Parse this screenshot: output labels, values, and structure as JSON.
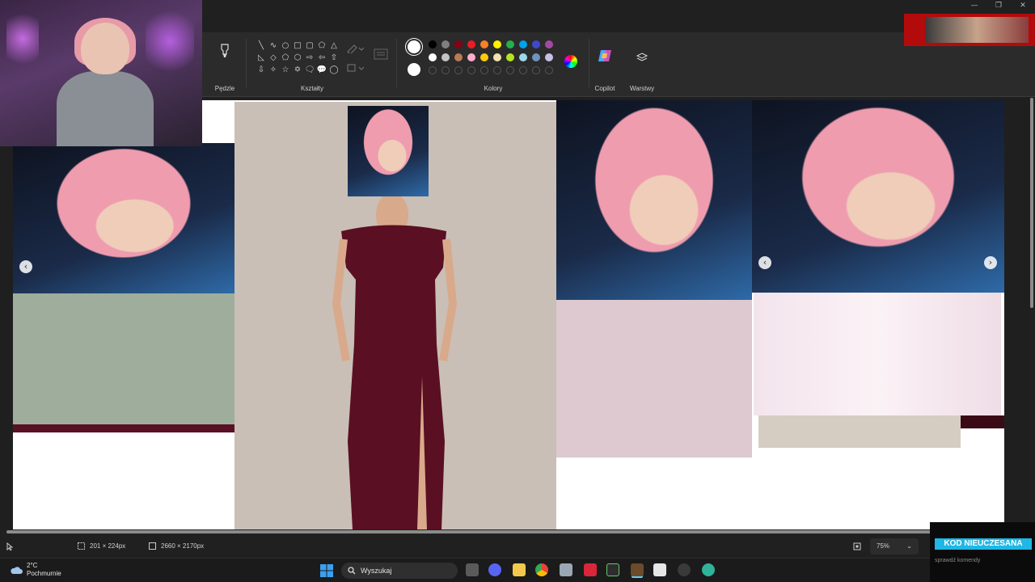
{
  "ribbon": {
    "brushes_label": "Pędzle",
    "shapes_label": "Kształty",
    "colors_label": "Kolory",
    "copilot_label": "Copilot",
    "layers_label": "Warstwy",
    "palette_row1": [
      "#000000",
      "#7f7f7f",
      "#880015",
      "#ed1c24",
      "#ff7f27",
      "#fff200",
      "#22b14c",
      "#00a2e8",
      "#3f48cc",
      "#a349a4"
    ],
    "palette_row2": [
      "#ffffff",
      "#c3c3c3",
      "#b97a57",
      "#ffaec9",
      "#ffc90e",
      "#efe4b0",
      "#b5e61d",
      "#99d9ea",
      "#7092be",
      "#c8bfe7"
    ]
  },
  "status": {
    "selection_size": "201 × 224px",
    "canvas_size": "2660 × 2170px",
    "zoom": "75%"
  },
  "taskbar": {
    "temperature": "2°C",
    "weather": "Pochmurnie",
    "search_placeholder": "Wyszukaj"
  },
  "overlay": {
    "kod_title": "KOD NIEUCZESANA",
    "kod_sub": "sprawdź komendy"
  },
  "window": {
    "minimize": "—",
    "maximize": "❐",
    "close": "✕"
  }
}
